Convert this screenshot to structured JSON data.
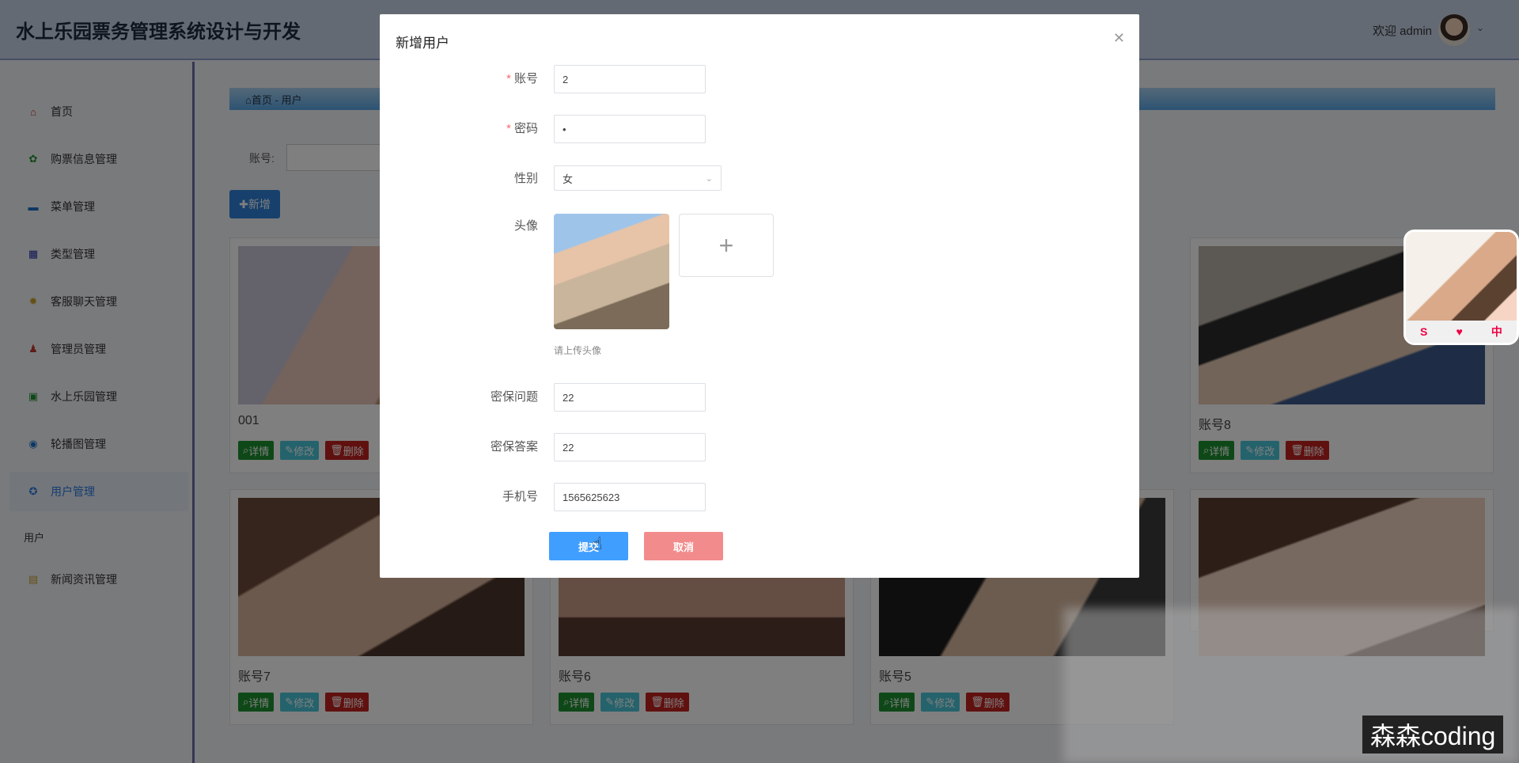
{
  "header": {
    "title": "水上乐园票务管理系统设计与开发",
    "welcome": "欢迎 admin"
  },
  "sidebar": {
    "items": [
      {
        "label": "首页",
        "icon": "home-icon",
        "color": "#c0392b"
      },
      {
        "label": "购票信息管理",
        "icon": "clover-icon",
        "color": "#1e9030"
      },
      {
        "label": "菜单管理",
        "icon": "folder-icon",
        "color": "#1a6fc9"
      },
      {
        "label": "类型管理",
        "icon": "grid-icon",
        "color": "#2330a8"
      },
      {
        "label": "客服聊天管理",
        "icon": "sun-icon",
        "color": "#c9a227"
      },
      {
        "label": "管理员管理",
        "icon": "person-icon",
        "color": "#c0392b"
      },
      {
        "label": "水上乐园管理",
        "icon": "briefcase-icon",
        "color": "#1e9030"
      },
      {
        "label": "轮播图管理",
        "icon": "circle-icon",
        "color": "#1a6fc9"
      },
      {
        "label": "用户管理",
        "icon": "badge-icon",
        "color": "#2d7be0"
      }
    ],
    "sub_label": "用户",
    "last_item": {
      "label": "新闻资讯管理",
      "icon": "box-icon",
      "color": "#c9a227"
    }
  },
  "breadcrumb": {
    "home": "⌂首页",
    "sep": "-",
    "current": "用户"
  },
  "search": {
    "label": "账号:"
  },
  "toolbar": {
    "add_label": "✚新增"
  },
  "cards": [
    {
      "name": "001"
    },
    {
      "name": "账号8"
    },
    {
      "name": "账号7"
    },
    {
      "name": "账号6"
    },
    {
      "name": "账号5"
    }
  ],
  "card_buttons": {
    "detail": "详情",
    "edit": "修改",
    "delete": "删除"
  },
  "dialog": {
    "title": "新增用户",
    "fields": {
      "account": {
        "label": "账号",
        "value": "2"
      },
      "password": {
        "label": "密码",
        "value": "•"
      },
      "gender": {
        "label": "性别",
        "value": "女"
      },
      "avatar": {
        "label": "头像",
        "hint": "请上传头像"
      },
      "question": {
        "label": "密保问题",
        "value": "22"
      },
      "answer": {
        "label": "密保答案",
        "value": "22"
      },
      "phone": {
        "label": "手机号",
        "value": "1565625623"
      }
    },
    "submit_label": "提交",
    "cancel_label": "取消"
  },
  "watermark": "森森coding"
}
